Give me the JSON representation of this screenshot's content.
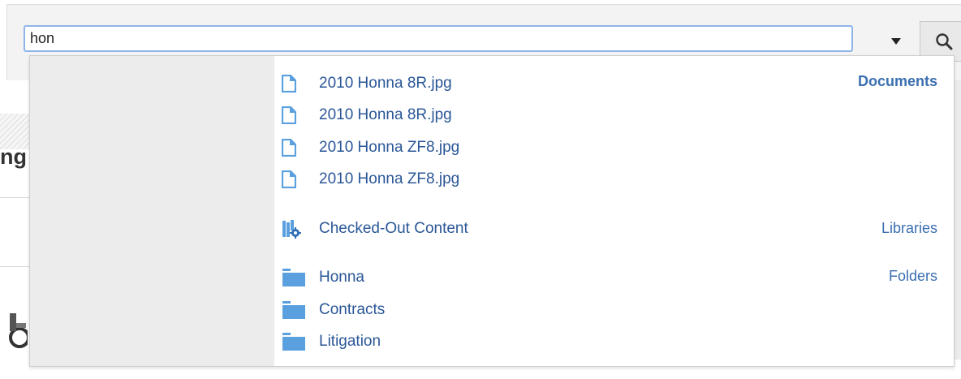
{
  "search": {
    "value": "hon"
  },
  "background": {
    "text_fragment": "ng"
  },
  "popup": {
    "sections": [
      {
        "label": "Documents",
        "items": [
          {
            "label": "2010 Honna 8R.jpg",
            "icon": "document-icon"
          },
          {
            "label": "2010 Honna 8R.jpg",
            "icon": "document-icon"
          },
          {
            "label": "2010 Honna ZF8.jpg",
            "icon": "document-icon"
          },
          {
            "label": "2010 Honna ZF8.jpg",
            "icon": "document-icon"
          }
        ]
      },
      {
        "label": "Libraries",
        "items": [
          {
            "label": "Checked-Out Content",
            "icon": "library-gear-icon"
          }
        ]
      },
      {
        "label": "Folders",
        "items": [
          {
            "label": "Honna",
            "icon": "folder-icon"
          },
          {
            "label": "Contracts",
            "icon": "folder-icon"
          },
          {
            "label": "Litigation",
            "icon": "folder-icon"
          }
        ]
      }
    ]
  },
  "colors": {
    "link": "#2b5797",
    "category": "#3b6fb0",
    "icon": "#5aa0de",
    "category_panel": "#ececec"
  }
}
